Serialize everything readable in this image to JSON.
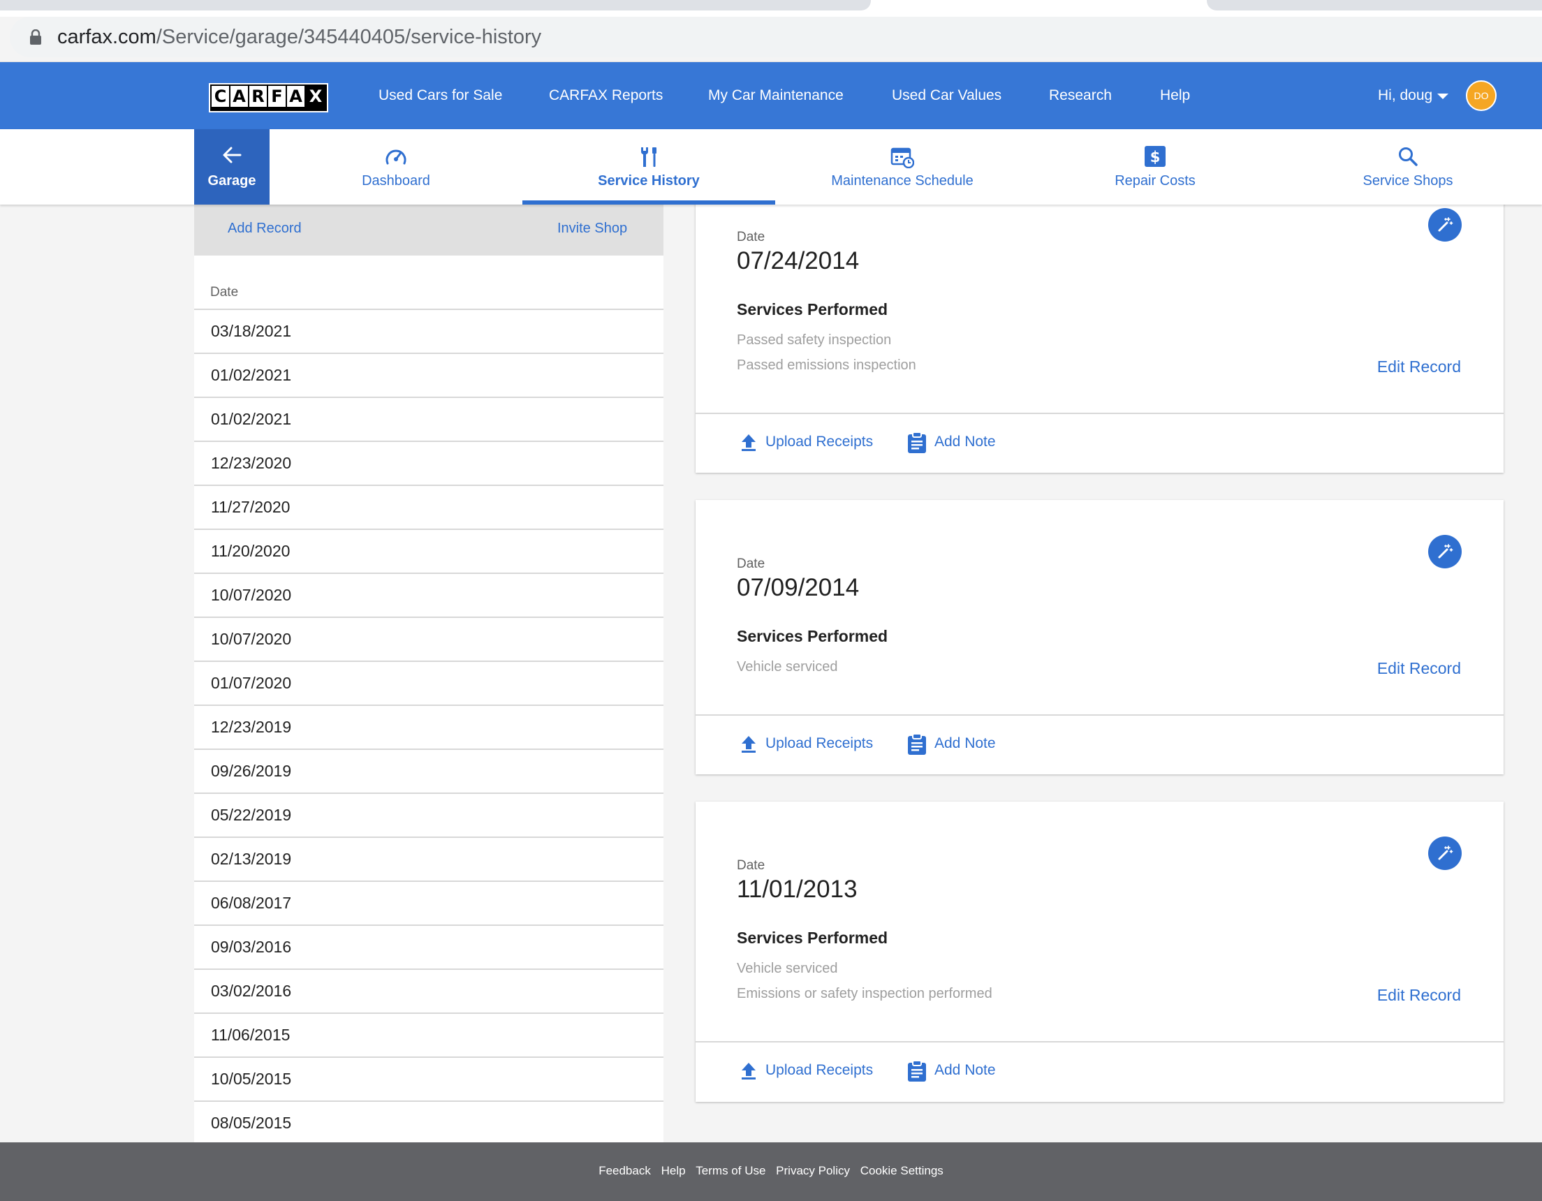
{
  "browser": {
    "url_host": "carfax.com",
    "url_path": "/Service/garage/345440405/service-history"
  },
  "brand": {
    "logo_letters": [
      "C",
      "A",
      "R",
      "F",
      "A",
      "X"
    ]
  },
  "topnav": {
    "links": [
      "Used Cars for Sale",
      "CARFAX Reports",
      "My Car Maintenance",
      "Used Car Values",
      "Research",
      "Help"
    ],
    "greeting": "Hi, doug",
    "avatar_initials": "DO"
  },
  "subnav": {
    "garage_label": "Garage",
    "tabs": [
      {
        "label": "Dashboard",
        "icon": "speedometer-icon"
      },
      {
        "label": "Service History",
        "icon": "wrench-screwdriver-icon",
        "active": true
      },
      {
        "label": "Maintenance Schedule",
        "icon": "calendar-clock-icon"
      },
      {
        "label": "Repair Costs",
        "icon": "dollar-icon"
      },
      {
        "label": "Service Shops",
        "icon": "search-icon"
      }
    ]
  },
  "left_panel": {
    "add_record": "Add Record",
    "invite_shop": "Invite Shop",
    "column_header": "Date",
    "dates": [
      "03/18/2021",
      "01/02/2021",
      "01/02/2021",
      "12/23/2020",
      "11/27/2020",
      "11/20/2020",
      "10/07/2020",
      "10/07/2020",
      "01/07/2020",
      "12/23/2019",
      "09/26/2019",
      "05/22/2019",
      "02/13/2019",
      "06/08/2017",
      "09/03/2016",
      "03/02/2016",
      "11/06/2015",
      "10/05/2015",
      "08/05/2015"
    ]
  },
  "records": [
    {
      "date_label": "Date",
      "date": "07/24/2014",
      "services_title": "Services Performed",
      "services": [
        "Passed safety inspection",
        "Passed emissions inspection"
      ],
      "edit": "Edit Record",
      "upload": "Upload Receipts",
      "note": "Add Note"
    },
    {
      "date_label": "Date",
      "date": "07/09/2014",
      "services_title": "Services Performed",
      "services": [
        "Vehicle serviced"
      ],
      "edit": "Edit Record",
      "upload": "Upload Receipts",
      "note": "Add Note"
    },
    {
      "date_label": "Date",
      "date": "11/01/2013",
      "services_title": "Services Performed",
      "services": [
        "Vehicle serviced",
        "Emissions or safety inspection performed"
      ],
      "edit": "Edit Record",
      "upload": "Upload Receipts",
      "note": "Add Note"
    }
  ],
  "footer": {
    "links": [
      "Feedback",
      "Help",
      "Terms of Use",
      "Privacy Policy",
      "Cookie Settings"
    ]
  },
  "colors": {
    "brand_blue": "#3777d6",
    "garage_blue": "#2d64bd",
    "link_blue": "#2f6fd0",
    "avatar_orange": "#f5a623",
    "footer_gray": "#616266"
  }
}
